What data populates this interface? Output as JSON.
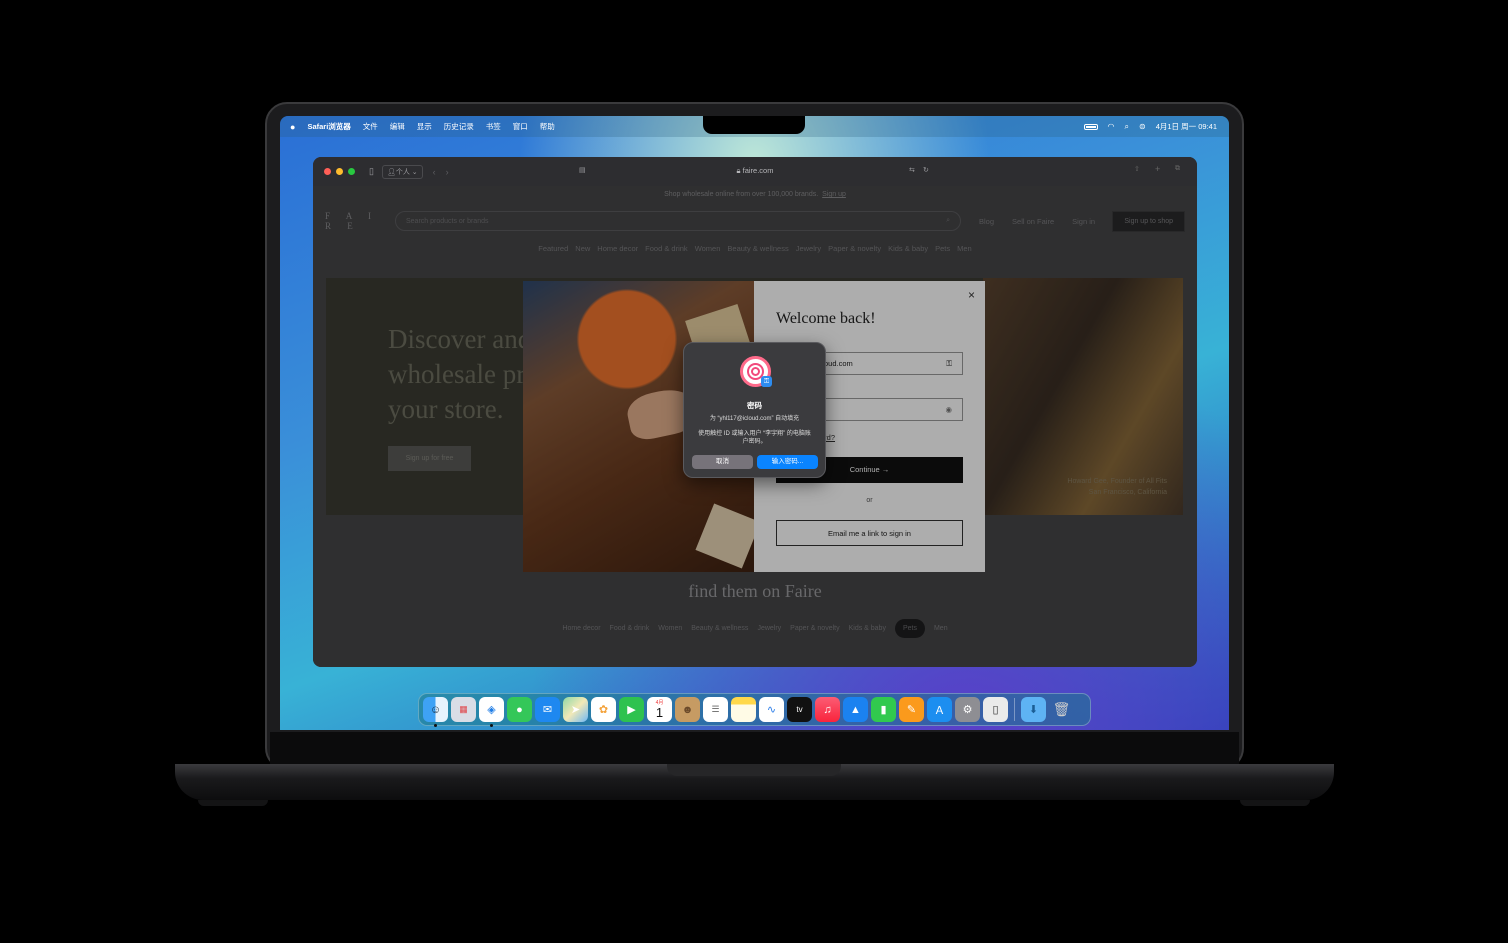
{
  "menubar": {
    "apple": "",
    "app": "Safari浏览器",
    "items": [
      "文件",
      "编辑",
      "显示",
      "历史记录",
      "书签",
      "窗口",
      "帮助"
    ],
    "clock": "4月1日 周一  09:41"
  },
  "browser": {
    "profile": "个人",
    "url": "faire.com",
    "translate_icon": "translate-icon",
    "reload_icon": "reload-icon"
  },
  "faire": {
    "banner_text": "Shop wholesale online from over 100,000 brands.",
    "banner_link": "Sign up",
    "logo": "F A I R E",
    "search_placeholder": "Search products or brands",
    "header_links": [
      "Blog",
      "Sell on Faire",
      "Sign in"
    ],
    "signup_button": "Sign up to shop",
    "categories": [
      "Featured",
      "New",
      "Home decor",
      "Food & drink",
      "Women",
      "Beauty & wellness",
      "Jewelry",
      "Paper & novelty",
      "Kids & baby",
      "Pets",
      "Men"
    ],
    "hero_lines": [
      "Discover and buy",
      "wholesale products",
      "your store."
    ],
    "hero_button": "Sign up for free",
    "hero_caption_line1": "Howard Gee, Founder of All Fits",
    "hero_caption_line2": "San Francisco, California",
    "tagline": "find them on Faire",
    "pill_categories": [
      "Home decor",
      "Food & drink",
      "Women",
      "Beauty & wellness",
      "Jewelry",
      "Paper & novelty",
      "Kids & baby",
      "Pets",
      "Men"
    ],
    "selected_pill": "Pets"
  },
  "modal": {
    "title": "Welcome back!",
    "email_value": "oud.com",
    "forgot": "ord?",
    "continue": "Continue →",
    "or": "or",
    "email_link": "Email me a link to sign in",
    "close": "×"
  },
  "dialog": {
    "title": "密码",
    "subtitle": "为 “yhl117@icloud.com” 自动填充",
    "body": "使用触控 ID 或输入用户 “李宇翔” 的电脑账户密码。",
    "cancel": "取消",
    "enter": "输入密码..."
  },
  "dock": {
    "apps": [
      "finder",
      "launchpad",
      "safari",
      "messages",
      "mail",
      "maps",
      "photos",
      "facetime",
      "calendar",
      "contacts",
      "reminders",
      "notes",
      "freeform",
      "tv",
      "music",
      "keynote",
      "numbers",
      "pages",
      "app-store",
      "system-settings",
      "iphone-mirroring"
    ],
    "calendar_month": "4月",
    "calendar_day": "1",
    "tv_label": "tv",
    "folder": "downloads",
    "trash": "trash"
  },
  "colors": {
    "accent": "#0a84ff",
    "modal_button": "#111111"
  }
}
